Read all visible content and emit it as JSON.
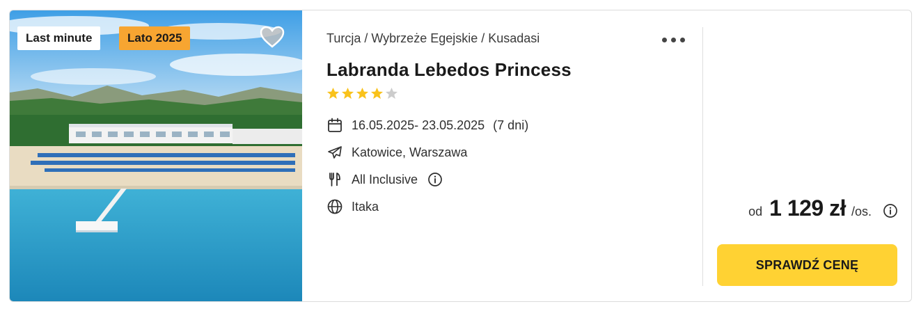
{
  "photo": {
    "badges": {
      "last_minute": "Last minute",
      "season": "Lato 2025"
    },
    "heart_icon": "heart-icon",
    "colors": {
      "season_badge": "#f7a531",
      "sea": "#2aa0c8",
      "sky": "#4aa6e8"
    }
  },
  "hotel": {
    "breadcrumb": "Turcja / Wybrzeże Egejskie / Kusadasi",
    "name": "Labranda Lebedos Princess",
    "rating": {
      "filled": 4,
      "max": 5
    },
    "dates": "16.05.2025- 23.05.2025",
    "duration": "(7 dni)",
    "departure": "Katowice, Warszawa",
    "board": "All Inclusive",
    "operator": "Itaka",
    "more_icon": "more-dots-icon"
  },
  "price": {
    "from": "od",
    "amount": "1 129 zł",
    "per": "/os.",
    "cta": "SPRAWDŹ CENĘ",
    "colors": {
      "cta": "#ffd233",
      "star": "#f9c21b",
      "star_empty": "#cccccc"
    }
  }
}
